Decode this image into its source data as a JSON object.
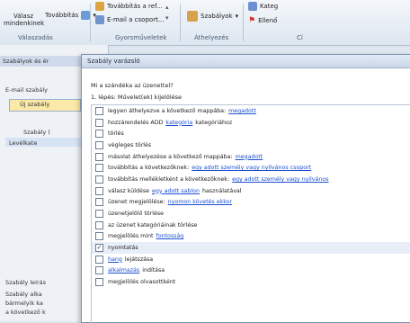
{
  "ribbon": {
    "reply_all_label": "Válasz mindenkinek",
    "forward_label": "Továbbítás",
    "group1_label": "Válaszadás",
    "meeting_label": "Továbbítás a ref...",
    "email_team_label": "E-mail a csoport...",
    "group2_label": "Gyorsműveletek",
    "rules_label": "Szabályok",
    "group3_label": "Áthelyezés",
    "group4_label": "Címkék",
    "edge_label_1": "Kateg",
    "edge_label_2": "Ellenő",
    "edge_label_3": "Cí"
  },
  "background": {
    "pane_title": "Szabályok és ér",
    "email_rules": "E-mail szabály",
    "new_rule_btn": "Új szabály",
    "col_rule": "Szabály (",
    "rule_item": "Levélkate",
    "desc_title": "Szabály leírás",
    "desc_line1": "Szabály alka",
    "desc_line2": "bármelyik ka",
    "desc_line3": "a következő k"
  },
  "dialog": {
    "title": "Szabály varázsló",
    "question": "Mi a szándéka az üzenettel?",
    "step": "1. lépés: Művelet(ek) kijelölése",
    "items": [
      {
        "text": "legyen áthelyezve a következő mappába:",
        "link": "megadott",
        "checked": false
      },
      {
        "text": "hozzárendelés ADD",
        "link": "kategória",
        "after": "kategóriához",
        "checked": false
      },
      {
        "text": "törlés",
        "link": "",
        "checked": false
      },
      {
        "text": "végleges törlés",
        "link": "",
        "checked": false
      },
      {
        "text": "másolat áthelyezése a következő mappába:",
        "link": "megadott",
        "checked": false
      },
      {
        "text": "továbbítás a következőknek:",
        "link": "egy adott személy vagy nyilvános csoport",
        "checked": false
      },
      {
        "text": "továbbítás mellékletként a következőknek:",
        "link": "egy adott személy vagy nyilvános",
        "checked": false
      },
      {
        "text": "válasz küldése",
        "link": "egy adott sablon",
        "after": "használatával",
        "checked": false
      },
      {
        "text": "üzenet megjelölése:",
        "link": "nyomon követés ekkor",
        "checked": false
      },
      {
        "text": "üzenetjelölő törlése",
        "link": "",
        "checked": false
      },
      {
        "text": "az üzenet kategóriáinak törlése",
        "link": "",
        "checked": false
      },
      {
        "text": "megjelölés mint",
        "link": "fontosság",
        "checked": false
      },
      {
        "text": "nyomtatás",
        "link": "",
        "checked": true
      },
      {
        "text": "",
        "link": "hang",
        "after": "lejátszása",
        "checked": false
      },
      {
        "text": "",
        "link": "alkalmazás",
        "after": "indítása",
        "checked": false
      },
      {
        "text": "megjelölés olvasottként",
        "link": "",
        "checked": false
      }
    ]
  }
}
